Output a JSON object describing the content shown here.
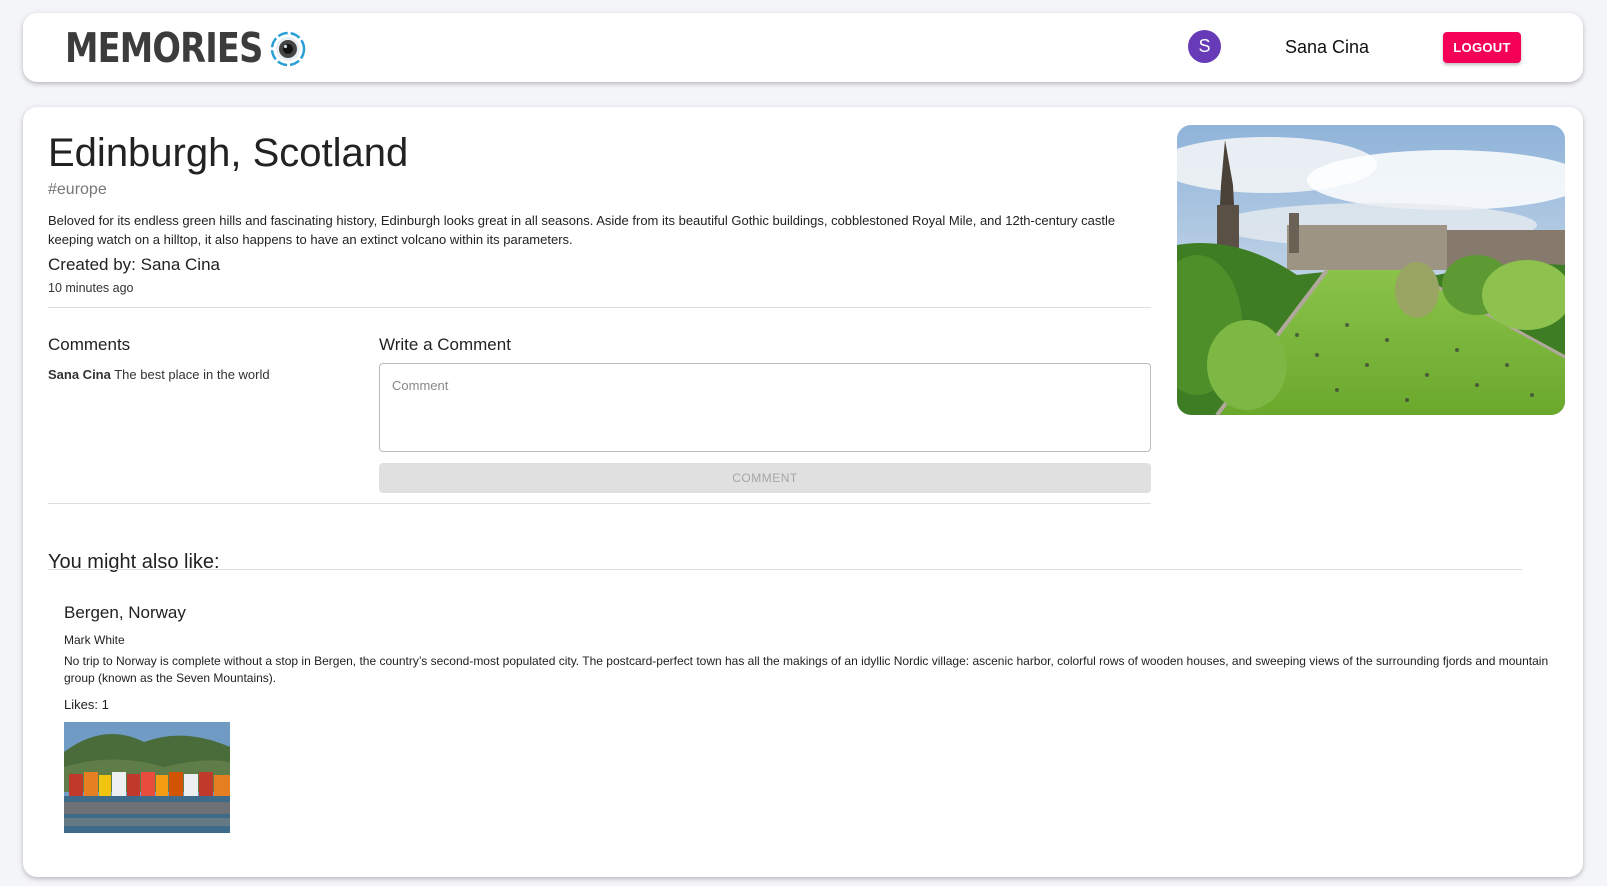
{
  "header": {
    "brand": "MEMORIES",
    "avatar_initial": "S",
    "user_name": "Sana Cina",
    "logout_label": "LOGOUT"
  },
  "post": {
    "title": "Edinburgh, Scotland",
    "tags": "#europe",
    "message": "Beloved for its endless green hills and fascinating history, Edinburgh looks great in all seasons. Aside from its beautiful Gothic buildings, cobblestoned Royal Mile, and 12th-century castle keeping watch on a hilltop, it also happens to have an extinct volcano within its parameters.",
    "creator": "Created by: Sana Cina",
    "created_at": "10 minutes ago"
  },
  "comments": {
    "title": "Comments",
    "items": [
      {
        "author": "Sana Cina",
        "text": " The best place in the world"
      }
    ],
    "write_title": "Write a Comment",
    "input_placeholder": "Comment",
    "submit_label": "COMMENT"
  },
  "recommended": {
    "title": "You might also like:",
    "items": [
      {
        "title": "Bergen, Norway",
        "author": "Mark White",
        "message": "No trip to Norway is complete without a stop in Bergen, the country’s second-most populated city. The postcard-perfect town has all the makings of an idyllic Nordic village: ascenic harbor, colorful rows of wooden houses, and sweeping views of the surrounding fjords and mountain group (known as the Seven Mountains).",
        "likes": "Likes: 1"
      }
    ]
  },
  "colors": {
    "avatar": "#673ab7",
    "logout": "#f50057",
    "background": "#f4f5f9"
  }
}
